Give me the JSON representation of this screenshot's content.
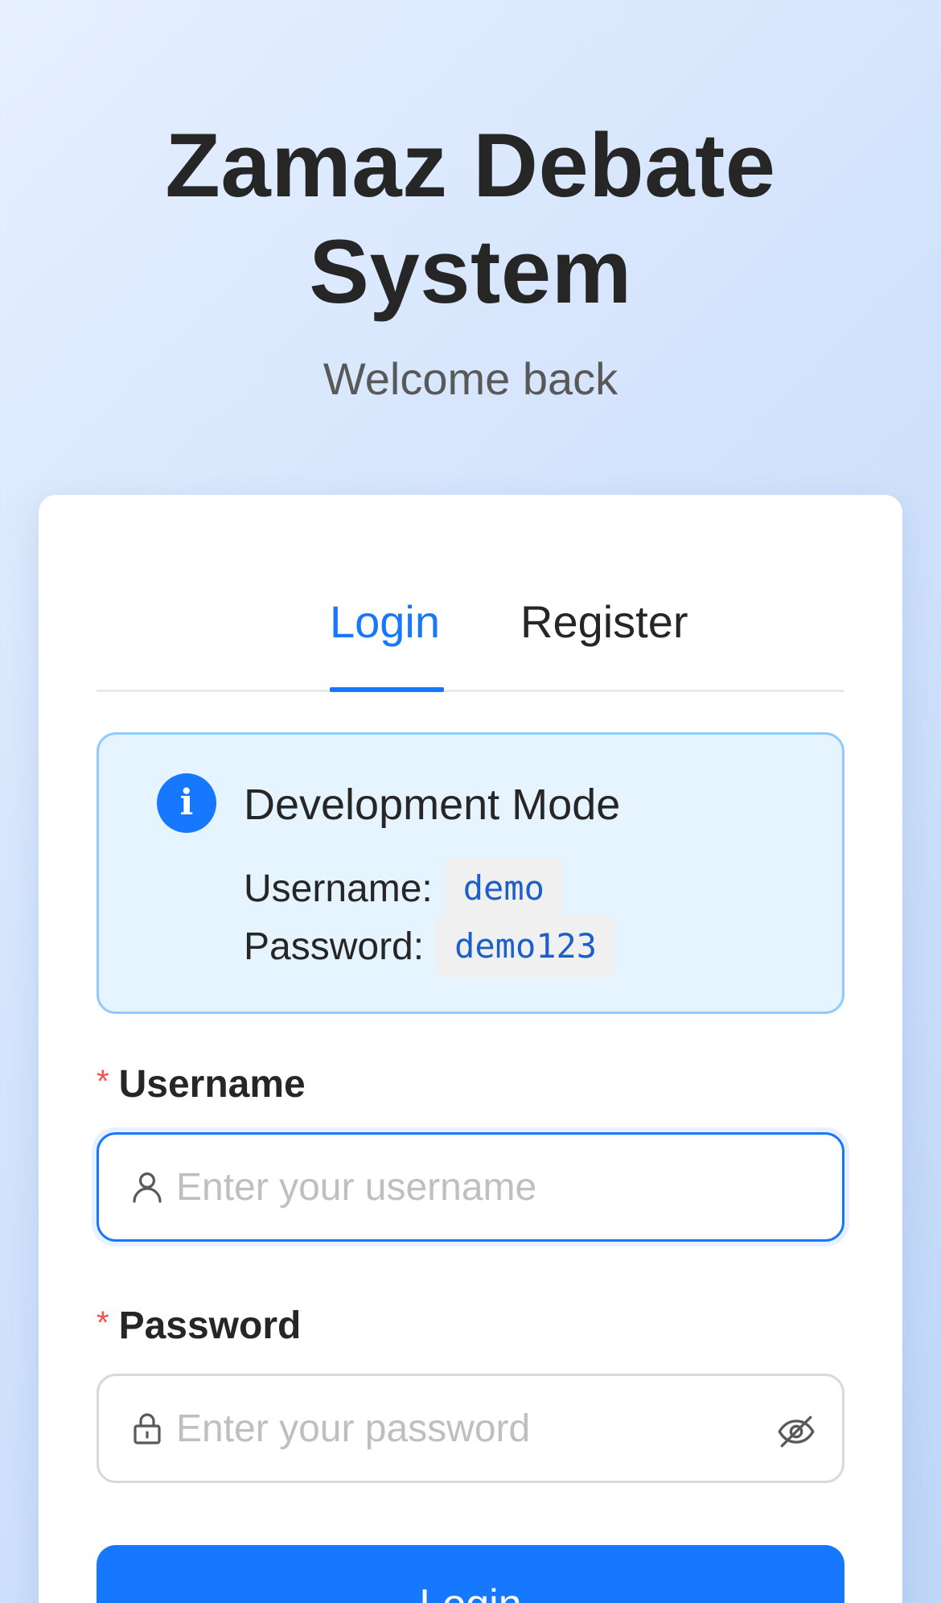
{
  "header": {
    "title": "Zamaz Debate System",
    "subtitle": "Welcome back"
  },
  "tabs": [
    {
      "label": "Login",
      "active": true
    },
    {
      "label": "Register",
      "active": false
    }
  ],
  "alert": {
    "icon": "info-icon",
    "title": "Development Mode",
    "username_label": "Username:",
    "username_value": "demo",
    "password_label": "Password:",
    "password_value": "demo123"
  },
  "form": {
    "required_mark": "*",
    "username": {
      "label": "Username",
      "placeholder": "Enter your username",
      "value": "",
      "icon": "user-icon"
    },
    "password": {
      "label": "Password",
      "placeholder": "Enter your password",
      "value": "",
      "icon": "lock-icon",
      "toggle_icon": "eye-hidden-icon"
    },
    "submit_label": "Login"
  },
  "colors": {
    "primary": "#1677ff",
    "required": "#ff4d4f",
    "alert_bg": "#e6f4ff",
    "alert_border": "#91caff"
  }
}
